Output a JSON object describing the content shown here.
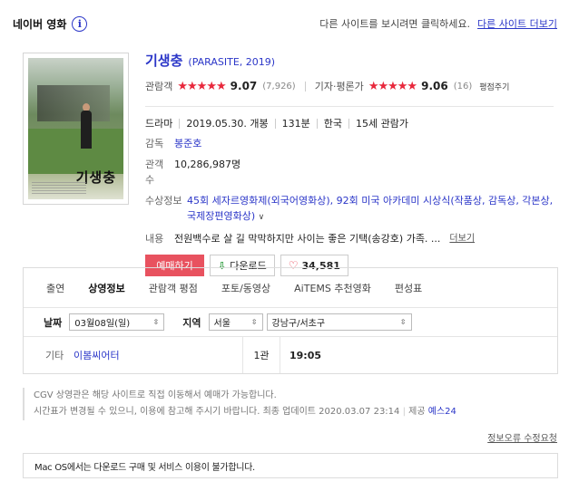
{
  "header": {
    "title": "네이버 영화",
    "info_icon": "i",
    "notice": "다른 사이트를 보시려면 클릭하세요.",
    "link": "다른 사이트 더보기"
  },
  "movie": {
    "poster_title": "기생충",
    "title_kr": "기생충",
    "title_en": "(PARASITE, 2019)",
    "audience": {
      "label": "관람객",
      "stars": "★★★★★",
      "score": "9.07",
      "count": "(7,926)"
    },
    "critic": {
      "label": "기자·평론가",
      "stars": "★★★★★",
      "score": "9.06",
      "count": "(16)",
      "action": "평점주기"
    },
    "genre": "드라마",
    "release": "2019.05.30. 개봉",
    "runtime": "131분",
    "country": "한국",
    "age": "15세 관람가",
    "director_label": "감독",
    "director": "봉준호",
    "viewers_label": "관객수",
    "viewers": "10,286,987명",
    "awards_label": "수상정보",
    "awards": "45회 세자르영화제(외국어영화상), 92회 미국 아카데미 시상식(작품상, 감독상, 각본상, 국제장편영화상)",
    "desc_label": "내용",
    "desc": "전원백수로 살 길 막막하지만 사이는 좋은 기택(송강호) 가족. ...",
    "desc_more": "더보기"
  },
  "buttons": {
    "reserve": "예매하기",
    "download": "다운로드",
    "like_count": "34,581"
  },
  "tabs": [
    "출연",
    "상영정보",
    "관람객 평점",
    "포토/동영상",
    "AiTEMS 추천영화",
    "편성표"
  ],
  "active_tab": "상영정보",
  "filter": {
    "date_label": "날짜",
    "date_value": "03월08일(일)",
    "region_label": "지역",
    "region_value": "서울",
    "district_value": "강남구/서초구"
  },
  "schedule": {
    "type": "기타",
    "theater": "이봄씨어터",
    "hall": "1관",
    "time": "19:05"
  },
  "notes": {
    "line1": "CGV 상영관은 해당 사이트로 직접 이동해서 예매가 가능합니다.",
    "line2": "시간표가 변경될 수 있으니, 이용에 참고해 주시기 바랍니다. 최종 업데이트 2020.03.07 23:14",
    "provider_label": "제공",
    "provider": "예스24"
  },
  "report_link": "정보오류 수정요청",
  "mac_notice": "Mac OS에서는 다운로드 구매 및 서비스 이용이 불가합니다."
}
